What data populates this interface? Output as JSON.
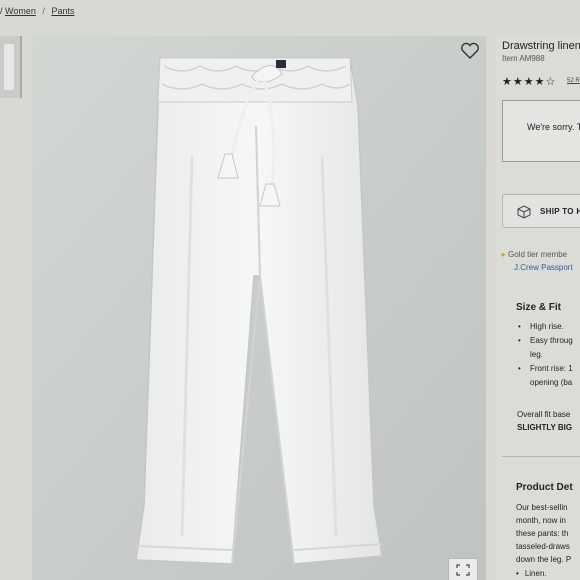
{
  "breadcrumb": {
    "sep": "/",
    "women": "Women",
    "pants": "Pants"
  },
  "product": {
    "title": "Drawstring linen",
    "item_number": "Item AM988",
    "stars": "★★★★☆",
    "rating": 4.5,
    "reviews": "52 R",
    "unavailable": "We're sorry. T",
    "ship_label": "SHIP TO H",
    "gold_line1": "Gold tier membe",
    "gold_line2": "J.Crew Passport"
  },
  "size_fit": {
    "heading": "Size & Fit",
    "bullets": [
      {
        "line1": "High rise.",
        "line2": ""
      },
      {
        "line1": "Easy throug",
        "line2": "leg."
      },
      {
        "line1": "Front rise: 1",
        "line2": "opening (ba"
      }
    ],
    "overall_label": "Overall fit base",
    "overall_value": "SLIGHTLY BIG"
  },
  "details": {
    "heading": "Product Det",
    "lines": [
      "Our best-sellin",
      "month, now in",
      "these pants: th",
      "tasseled-draws",
      "down the leg. P"
    ],
    "material": "Linen."
  },
  "icons": {
    "wishlist": "heart-icon",
    "expand": "expand-icon",
    "ship": "box-icon",
    "gold": "location-pin-icon"
  },
  "colors": {
    "accent_link": "#2f5c9e",
    "gold": "#c9a243"
  }
}
